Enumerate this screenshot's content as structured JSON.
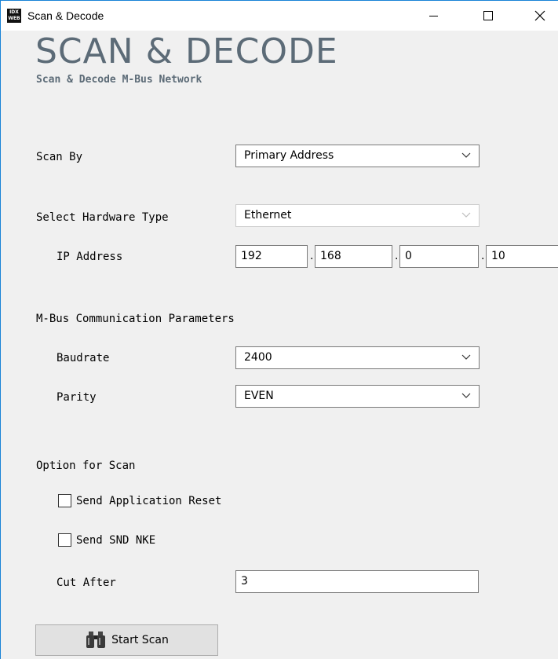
{
  "window": {
    "title": "Scan & Decode",
    "app_icon_text": "IDX WEB",
    "close_glyph": "✕"
  },
  "header": {
    "title": "SCAN & DECODE",
    "subtitle": "Scan & Decode M-Bus Network"
  },
  "form": {
    "scan_by": {
      "label": "Scan By",
      "value": "Primary Address"
    },
    "hardware_type": {
      "label": "Select Hardware Type",
      "value": "Ethernet",
      "disabled": true
    },
    "ip_address": {
      "label": "IP Address",
      "octets": [
        "192",
        "168",
        "0",
        "10"
      ],
      "separator": "."
    },
    "mbus_section": {
      "label": "M-Bus Communication Parameters"
    },
    "baudrate": {
      "label": "Baudrate",
      "value": "2400"
    },
    "parity": {
      "label": "Parity",
      "value": "EVEN"
    },
    "scan_options": {
      "label": "Option for Scan"
    },
    "send_application_reset": {
      "label": "Send Application Reset",
      "checked": false
    },
    "send_snd_nke": {
      "label": "Send SND NKE",
      "checked": false
    },
    "cut_after": {
      "label": "Cut After",
      "value": "3"
    }
  },
  "actions": {
    "start_scan": {
      "label": "Start Scan",
      "icon": "binoculars-icon"
    }
  }
}
